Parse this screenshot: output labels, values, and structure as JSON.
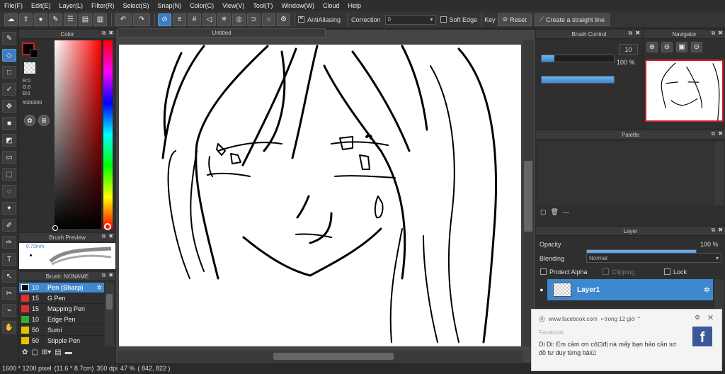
{
  "menubar": [
    "File(F)",
    "Edit(E)",
    "Layer(L)",
    "Filter(R)",
    "Select(S)",
    "Snap(N)",
    "Color(C)",
    "View(V)",
    "Tool(T)",
    "Window(W)",
    "Cloud",
    "Help"
  ],
  "toolbar": {
    "antialiasing_label": "AntiAliasing",
    "correction_label": "Correction",
    "correction_value": "0",
    "soft_edge_label": "Soft Edge",
    "key_label": "Key",
    "reset_label": "Reset",
    "straight_line_label": "Create a straight line"
  },
  "color_panel": {
    "title": "Color",
    "r": "R:0",
    "g": "G:0",
    "b": "B:0",
    "hex": "#000000",
    "foreground": "#000000",
    "accent_red": "#cc2020"
  },
  "brush_preview": {
    "title": "Brush Preview",
    "size": "0.73mm"
  },
  "brush_list": {
    "title": "Brush: NONAME",
    "items": [
      {
        "size": "10",
        "name": "Pen (Sharp)",
        "color": "#000000",
        "selected": true
      },
      {
        "size": "15",
        "name": "G Pen",
        "color": "#e03030"
      },
      {
        "size": "15",
        "name": "Mapping Pen",
        "color": "#e03030"
      },
      {
        "size": "10",
        "name": "Edge Pen",
        "color": "#30b030"
      },
      {
        "size": "50",
        "name": "Sumi",
        "color": "#e8c000"
      },
      {
        "size": "50",
        "name": "Stipple Pen",
        "color": "#e8c000"
      }
    ]
  },
  "document": {
    "tab_title": "Untitled"
  },
  "brush_control": {
    "title": "Brush Control",
    "size_value": "10",
    "opacity_value": "100 %"
  },
  "navigator": {
    "title": "Navigator"
  },
  "palette": {
    "title": "Palette",
    "count": "---"
  },
  "layer_panel": {
    "title": "Layer",
    "opacity_label": "Opacity",
    "opacity_value": "100 %",
    "blending_label": "Blending",
    "blending_value": "Normal",
    "protect_alpha_label": "Protect Alpha",
    "clipping_label": "Clipping",
    "lock_label": "Lock",
    "layer_name": "Layer1"
  },
  "statusbar": {
    "size": "1600 * 1200 pixel",
    "physical": "(11.6 * 8.7cm)",
    "dpi": "350 dpi",
    "zoom": "47 %",
    "coords": "( 842, 822 )"
  },
  "notification": {
    "source": "www.facebook.com",
    "time": "• trong 12 giờ ⌃",
    "app": "Facebook",
    "message": "Di Di: Em cảm ơn cô⊡đị nà mấy bạn bảo cần sơ đồ tư duy từng bài⊡"
  }
}
